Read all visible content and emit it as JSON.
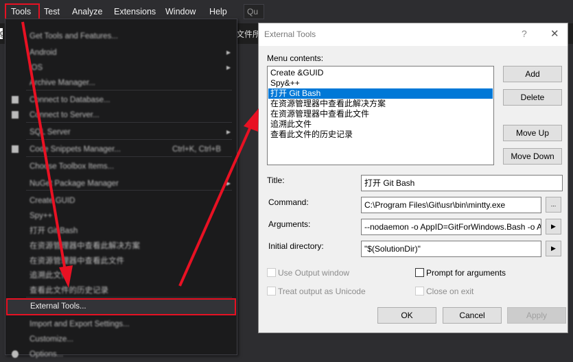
{
  "menubar": {
    "items": [
      "Tools",
      "Test",
      "Analyze",
      "Extensions",
      "Window",
      "Help"
    ],
    "quick_launch": "Qu"
  },
  "background": {
    "left_text": "g",
    "right_text": "文件所"
  },
  "tools_menu": {
    "items": [
      {
        "label": "Get Tools and Features..."
      },
      {
        "label": "Android",
        "submenu": true
      },
      {
        "label": "iOS",
        "submenu": true
      },
      {
        "label": "Archive Manager..."
      },
      {
        "label": "Connect to Database...",
        "icon": "database-icon"
      },
      {
        "label": "Connect to Server...",
        "icon": "server-icon"
      },
      {
        "label": "SQL Server",
        "submenu": true
      },
      {
        "label": "Code Snippets Manager...",
        "shortcut": "Ctrl+K, Ctrl+B",
        "icon": "snippet-icon"
      },
      {
        "label": "Choose Toolbox Items..."
      },
      {
        "label": "NuGet Package Manager",
        "submenu": true
      },
      {
        "label": "Create GUID"
      },
      {
        "label": "Spy++"
      },
      {
        "label": "打开 Git Bash"
      },
      {
        "label": "在资源管理器中查看此解决方案"
      },
      {
        "label": "在资源管理器中查看此文件"
      },
      {
        "label": "追溯此文件"
      },
      {
        "label": "查看此文件的历史记录"
      },
      {
        "label": "External Tools..."
      },
      {
        "label": "Import and Export Settings..."
      },
      {
        "label": "Customize..."
      },
      {
        "label": "Options...",
        "icon": "gear-icon"
      }
    ]
  },
  "dialog": {
    "title": "External Tools",
    "help": "?",
    "close": "✕",
    "menu_contents_label": "Menu contents:",
    "list": [
      "Create &GUID",
      "Spy&++",
      "打开 Git Bash",
      "在资源管理器中查看此解决方案",
      "在资源管理器中查看此文件",
      "追溯此文件",
      "查看此文件的历史记录"
    ],
    "selected_index": 2,
    "buttons": {
      "add": "Add",
      "delete": "Delete",
      "move_up": "Move Up",
      "move_down": "Move Down",
      "ok": "OK",
      "cancel": "Cancel",
      "apply": "Apply",
      "browse": "...",
      "arrow": "▶"
    },
    "fields": {
      "title_label": "Title:",
      "title_value": "打开 Git Bash",
      "command_label": "Command:",
      "command_value": "C:\\Program Files\\Git\\usr\\bin\\mintty.exe",
      "arguments_label": "Arguments:",
      "arguments_value": "--nodaemon -o AppID=GitForWindows.Bash -o AppLaunchCmd",
      "initdir_label": "Initial directory:",
      "initdir_value": "\"$(SolutionDir)\""
    },
    "checkboxes": {
      "use_output": "Use Output window",
      "prompt_args": "Prompt for arguments",
      "unicode": "Treat output as Unicode",
      "close_exit": "Close on exit"
    }
  },
  "colors": {
    "annotation": "#e81123",
    "selection": "#0078d7"
  }
}
